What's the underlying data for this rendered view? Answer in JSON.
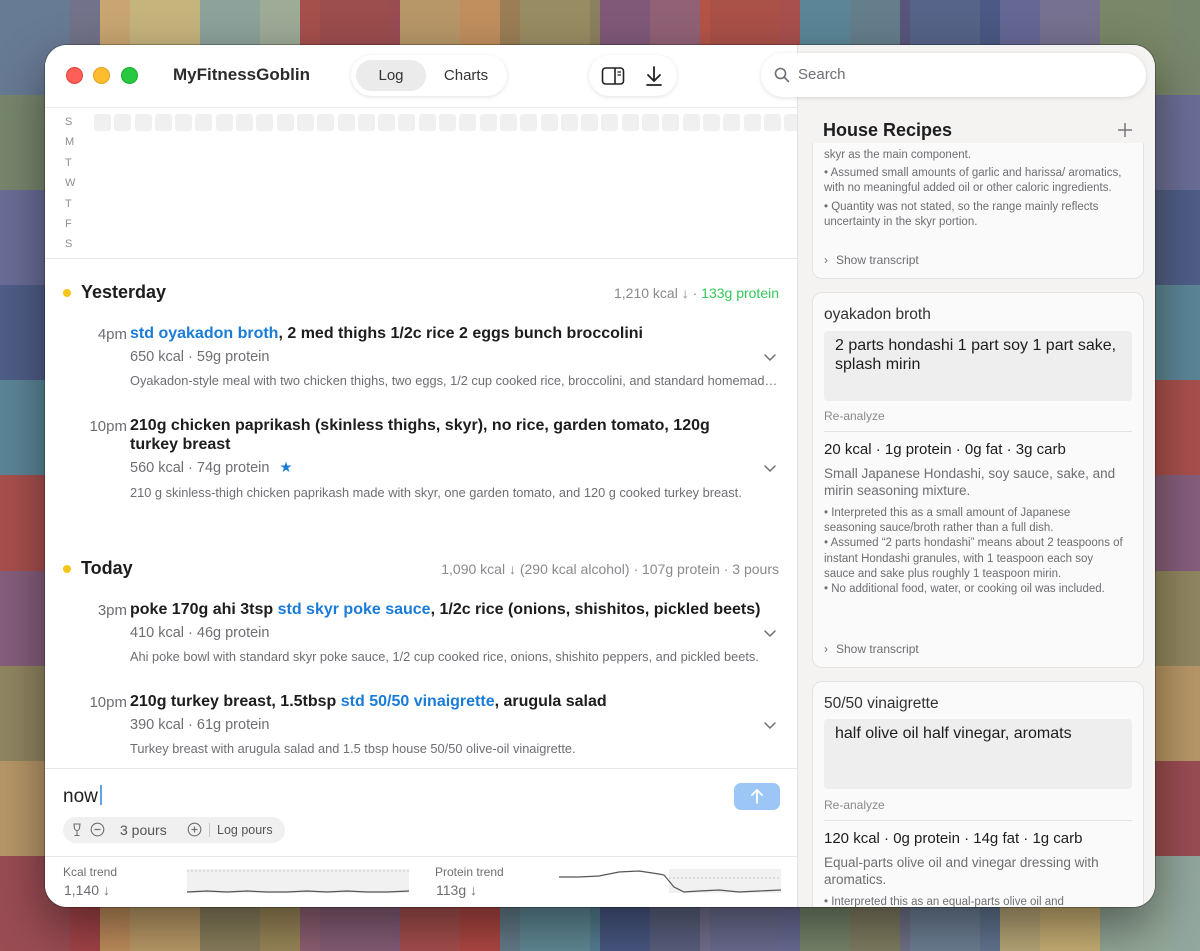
{
  "window": {
    "app_title": "MyFitnessGoblin",
    "tabs": [
      {
        "label": "Log",
        "active": true
      },
      {
        "label": "Charts",
        "active": false
      }
    ],
    "search_placeholder": "Search"
  },
  "heatmap": {
    "day_labels": [
      "S",
      "M",
      "T",
      "W",
      "T",
      "F",
      "S"
    ],
    "palette": {
      "0": "#f0f0f0",
      "1": "#6fd0c4",
      "2": "#5f79d3",
      "3": "#8fa5e3",
      "4": "#4fc94f",
      "5": "#8ed694",
      "6": "#e2bf9c",
      "7": "#c8e6a6",
      "8": "#7fb9e0",
      "9": "#e9e9e9"
    },
    "highlight_color": "#e0453f",
    "weeks": [
      [
        0,
        0,
        0,
        0,
        0,
        0,
        0
      ],
      [
        0,
        0,
        0,
        0,
        0,
        0,
        0
      ],
      [
        0,
        0,
        0,
        0,
        0,
        0,
        0
      ],
      [
        0,
        0,
        0,
        0,
        0,
        0,
        0
      ],
      [
        0,
        0,
        0,
        0,
        0,
        0,
        0
      ],
      [
        0,
        0,
        0,
        0,
        0,
        0,
        0
      ],
      [
        0,
        0,
        0,
        0,
        0,
        0,
        0
      ],
      [
        0,
        0,
        0,
        0,
        0,
        0,
        0
      ],
      [
        0,
        0,
        0,
        0,
        0,
        0,
        0
      ],
      [
        0,
        0,
        0,
        0,
        0,
        0,
        0
      ],
      [
        0,
        0,
        0,
        0,
        0,
        0,
        0
      ],
      [
        0,
        0,
        0,
        0,
        0,
        0,
        0
      ],
      [
        0,
        0,
        0,
        0,
        0,
        0,
        0
      ],
      [
        0,
        0,
        0,
        0,
        0,
        0,
        0
      ],
      [
        0,
        0,
        0,
        0,
        0,
        0,
        0
      ],
      [
        0,
        6,
        8,
        4,
        5,
        1,
        5
      ],
      [
        1,
        2,
        3,
        2,
        3,
        1,
        2
      ],
      [
        3,
        2,
        2,
        3,
        2,
        2,
        3
      ],
      [
        2,
        2,
        2,
        2,
        3,
        2,
        2
      ],
      [
        3,
        2,
        2,
        2,
        2,
        3,
        7
      ],
      [
        1,
        3,
        9,
        2,
        5,
        2,
        2
      ],
      [
        8,
        2,
        3,
        2,
        2,
        3,
        5
      ],
      [
        1,
        3,
        2,
        3,
        3,
        2,
        7
      ],
      [
        2,
        3,
        1,
        3,
        5,
        5,
        2
      ],
      [
        3,
        2,
        3,
        2,
        2,
        1,
        2
      ],
      [
        3,
        2,
        2,
        2,
        3,
        1,
        5
      ],
      [
        2,
        1,
        9,
        7,
        5,
        2,
        1
      ],
      [
        1,
        2,
        2,
        2,
        4,
        2,
        2
      ],
      [
        8,
        2,
        2,
        3,
        2,
        1,
        2
      ],
      [
        3,
        3,
        1,
        3,
        2,
        2,
        3
      ],
      [
        2,
        3,
        6,
        2,
        2,
        1,
        2
      ],
      [
        2,
        2,
        3,
        3,
        3,
        2,
        5
      ],
      [
        1,
        2,
        2,
        8,
        0,
        9,
        0
      ],
      [
        0,
        0,
        0,
        0,
        0,
        0,
        0
      ]
    ],
    "highlighted_cells": [
      [
        18,
        0
      ],
      [
        18,
        3
      ],
      [
        21,
        0
      ]
    ]
  },
  "days": [
    {
      "name": "Yesterday",
      "kcal": "1,210 kcal ↓",
      "protein": "133g protein",
      "extra": "",
      "entries": [
        {
          "time": "4pm",
          "link": "std oyakadon broth",
          "rest": ", 2 med thighs 1/2c rice 2 eggs bunch broccolini",
          "prefix": "",
          "meta": "650 kcal · 59g protein",
          "star": "",
          "desc": "Oyakadon-style meal with two chicken thighs, two eggs, 1/2 cup cooked rice, broccolini, and standard homemade oyakadon broth."
        },
        {
          "time": "10pm",
          "link": "",
          "rest": "",
          "prefix": "210g chicken paprikash (skinless thighs, skyr), no rice, garden tomato, 120g turkey breast",
          "meta": "560 kcal · 74g protein",
          "star": "★",
          "desc": "210 g skinless-thigh chicken paprikash made with skyr, one garden tomato, and 120 g cooked turkey breast."
        }
      ]
    },
    {
      "name": "Today",
      "kcal": "1,090 kcal ↓ (290 kcal alcohol) · 107g protein · 3 pours",
      "protein": "",
      "extra": "",
      "entries": [
        {
          "time": "3pm",
          "prefix": "poke 170g ahi 3tsp ",
          "link": "std skyr poke sauce",
          "rest": ", 1/2c rice (onions, shishitos, pickled beets)",
          "meta": "410 kcal · 46g protein",
          "star": "",
          "desc": "Ahi poke bowl with standard skyr poke sauce, 1/2 cup cooked rice, onions, shishito peppers, and pickled beets."
        },
        {
          "time": "10pm",
          "prefix": "210g turkey breast, 1.5tbsp ",
          "link": "std 50/50 vinaigrette",
          "rest": ", arugula salad",
          "meta": "390 kcal · 61g protein",
          "star": "",
          "desc": "Turkey breast with arugula salad and 1.5 tbsp house 50/50 olive-oil vinaigrette."
        }
      ]
    }
  ],
  "composer": {
    "input_value": "now",
    "pours": "3 pours",
    "log_pours": "Log pours"
  },
  "trends": {
    "kcal": {
      "label": "Kcal trend",
      "value": "1,140 ↓"
    },
    "protein": {
      "label": "Protein trend",
      "value": "113g ↓"
    }
  },
  "recipes": {
    "title": "House Recipes",
    "top_card": {
      "notes": [
        "skyr as the main component.",
        "• Assumed small amounts of garlic and harissa/ aromatics, with no meaningful added oil or other caloric ingredients.",
        "• Quantity was not stated, so the range mainly reflects uncertainty in the skyr portion."
      ],
      "show_transcript": "Show transcript"
    },
    "cards": [
      {
        "name": "oyakadon broth",
        "text": "2 parts hondashi 1 part soy 1 part sake, splash mirin",
        "reanalyze": "Re-analyze",
        "nutrition": "20 kcal · 1g protein · 0g fat · 3g carb",
        "desc": "Small Japanese Hondashi, soy sauce, sake, and mirin seasoning mixture.",
        "notes": [
          "• Interpreted this as a small amount of Japanese seasoning sauce/broth rather than a full dish.",
          "• Assumed “2 parts hondashi” means about 2 teaspoons of instant Hondashi granules, with 1 teaspoon each soy sauce and sake plus roughly 1 teaspoon mirin.",
          "• No additional food, water, or cooking oil was included."
        ],
        "show_transcript": "Show transcript"
      },
      {
        "name": "50/50 vinaigrette",
        "text": "half olive oil half vinegar, aromats",
        "reanalyze": "Re-analyze",
        "nutrition": "120 kcal · 0g protein · 14g fat · 1g carb",
        "desc": "Equal-parts olive oil and vinegar dressing with aromatics.",
        "notes": [
          "• Interpreted this as an equal-parts olive oil and"
        ],
        "show_transcript": ""
      }
    ]
  },
  "colors": {
    "accent": "#1a7cd9",
    "protein_green": "#34c759",
    "day_dot": "#f5c518",
    "send_button": "#9cc6f5"
  }
}
